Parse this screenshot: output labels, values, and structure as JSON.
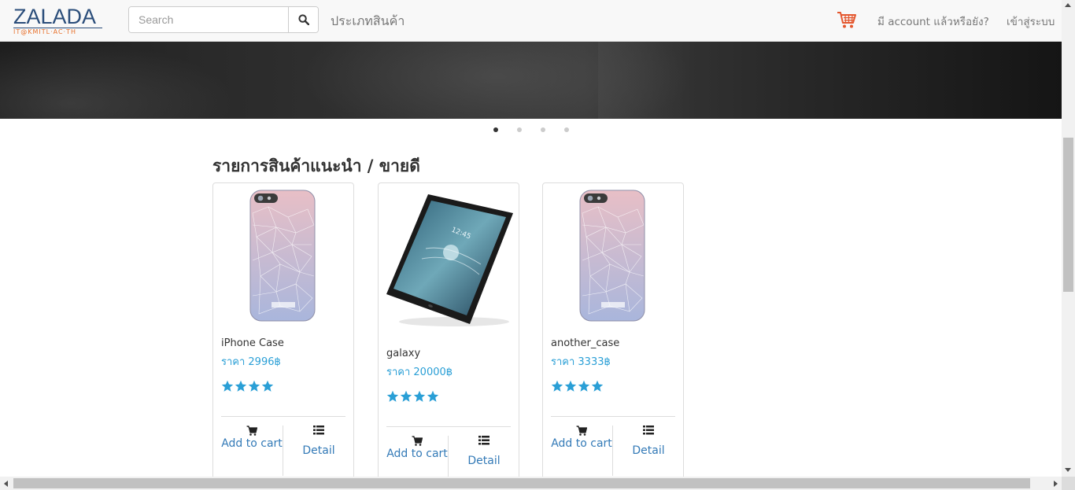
{
  "brand": {
    "name": "ZALADA",
    "tagline": "IT@KMITL·AC·TH"
  },
  "search": {
    "placeholder": "Search",
    "button_icon": "search-icon"
  },
  "nav": {
    "category": "ประเภทสินค้า",
    "cart_icon": "shopping-cart-icon",
    "register": "มี account แล้วหรือยัง?",
    "login": "เข้าสู่ระบบ"
  },
  "carousel": {
    "slides": 4,
    "active_index": 0
  },
  "section": {
    "title": "รายการสินค้าแนะนำ / ขายดี"
  },
  "products": [
    {
      "name": "iPhone Case",
      "price": "ราคา 2996฿",
      "rating": 4,
      "image": "phone-case-image",
      "add_label": "Add to cart",
      "detail_label": "Detail"
    },
    {
      "name": "galaxy",
      "price": "ราคา 20000฿",
      "rating": 4,
      "image": "tablet-image",
      "add_label": "Add to cart",
      "detail_label": "Detail"
    },
    {
      "name": "another_case",
      "price": "ราคา 3333฿",
      "rating": 4,
      "image": "phone-case-image",
      "add_label": "Add to cart",
      "detail_label": "Detail"
    }
  ],
  "colors": {
    "brand_blue": "#2a4d7a",
    "brand_orange": "#e8702a",
    "price_blue": "#2a9fd6",
    "link_blue": "#337ab7",
    "cart_orange": "#e4572e"
  }
}
